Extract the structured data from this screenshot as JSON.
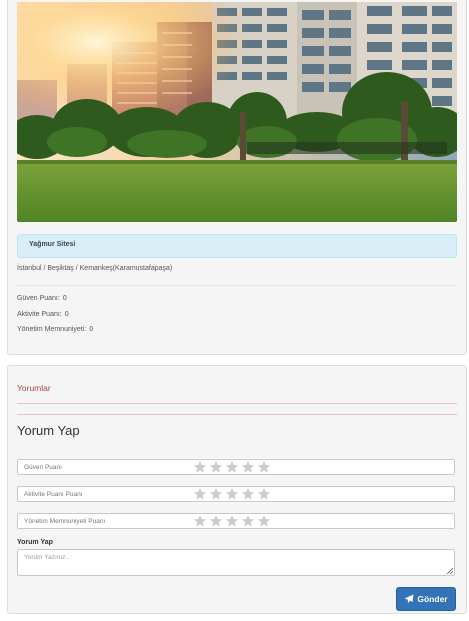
{
  "listing": {
    "photo_alt": "site-photo",
    "title": "Yağmur Sitesi",
    "location": "İstanbul / Beşiktaş / Kemankeş(Karamustafapaşa)",
    "stats": {
      "trust_label": "Güven Puanı:",
      "trust_value": "0",
      "activity_label": "Aktivite Puanı:",
      "activity_value": "0",
      "management_label": "Yönetim Memnuniyeti:",
      "management_value": "0"
    }
  },
  "comments": {
    "heading": "Yorumlar",
    "form_title": "Yorum Yap",
    "ratings": [
      {
        "placeholder": "Güven Puanı",
        "stars": 0,
        "max": 5
      },
      {
        "placeholder": "Aktivite Puanı Puanı",
        "stars": 0,
        "max": 5
      },
      {
        "placeholder": "Yönetim Memnuniyeti Puanı",
        "stars": 0,
        "max": 5
      }
    ],
    "comment_label": "Yorum Yap",
    "comment_placeholder": "Yorum Yazınız..",
    "send_label": "Gönder",
    "send_icon": "paper-plane-icon",
    "star_icon": "star-icon"
  },
  "colors": {
    "info_bg": "#d9edf7",
    "heading_red": "#a94442",
    "button_blue": "#3374b8",
    "star_empty": "#cccccc"
  }
}
